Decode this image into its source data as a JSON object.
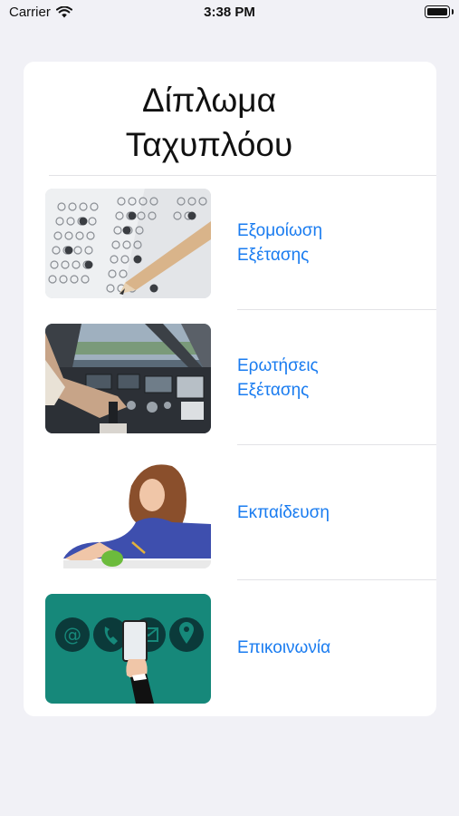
{
  "status_bar": {
    "carrier": "Carrier",
    "time": "3:38 PM"
  },
  "header": {
    "title": "Δίπλωμα\nΤαχυπλόου"
  },
  "menu": {
    "items": [
      {
        "label": "Εξομοίωση\nΕξέτασης",
        "image": "exam-answer-sheet-with-pencil"
      },
      {
        "label": "Ερωτήσεις\nΕξέτασης",
        "image": "boat-dashboard-controls"
      },
      {
        "label": "Εκπαίδευση",
        "image": "student-studying"
      },
      {
        "label": "Επικοινωνία",
        "image": "contact-icons-phone-in-hand"
      }
    ]
  },
  "colors": {
    "background": "#f1f1f6",
    "card": "#ffffff",
    "link": "#1a7cf0",
    "separator": "#e2e2e6"
  }
}
